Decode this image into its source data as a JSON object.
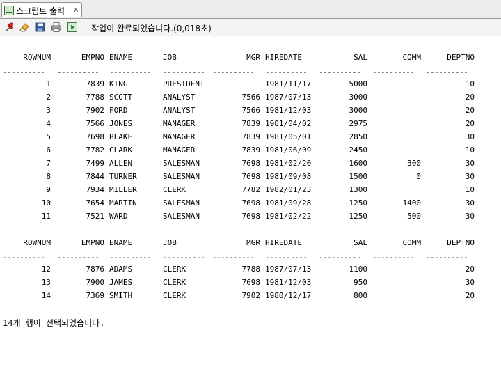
{
  "tab": {
    "label": "스크립트 출력",
    "close": "x"
  },
  "toolbar": {
    "status": "작업이 완료되었습니다.(0,018초)",
    "icons": [
      "pin-icon",
      "eraser-icon",
      "save-icon",
      "print-icon",
      "run-script-icon"
    ]
  },
  "columns": [
    "ROWNUM",
    "EMPNO",
    "ENAME",
    "JOB",
    "MGR",
    "HIREDATE",
    "SAL",
    "COMM",
    "DEPTNO"
  ],
  "dashes": "----------",
  "page1": [
    [
      "1",
      "7839",
      "KING",
      "PRESIDENT",
      "",
      "1981/11/17",
      "5000",
      "",
      "10"
    ],
    [
      "2",
      "7788",
      "SCOTT",
      "ANALYST",
      "7566",
      "1987/07/13",
      "3000",
      "",
      "20"
    ],
    [
      "3",
      "7902",
      "FORD",
      "ANALYST",
      "7566",
      "1981/12/03",
      "3000",
      "",
      "20"
    ],
    [
      "4",
      "7566",
      "JONES",
      "MANAGER",
      "7839",
      "1981/04/02",
      "2975",
      "",
      "20"
    ],
    [
      "5",
      "7698",
      "BLAKE",
      "MANAGER",
      "7839",
      "1981/05/01",
      "2850",
      "",
      "30"
    ],
    [
      "6",
      "7782",
      "CLARK",
      "MANAGER",
      "7839",
      "1981/06/09",
      "2450",
      "",
      "10"
    ],
    [
      "7",
      "7499",
      "ALLEN",
      "SALESMAN",
      "7698",
      "1981/02/20",
      "1600",
      "300",
      "30"
    ],
    [
      "8",
      "7844",
      "TURNER",
      "SALESMAN",
      "7698",
      "1981/09/08",
      "1500",
      "0",
      "30"
    ],
    [
      "9",
      "7934",
      "MILLER",
      "CLERK",
      "7782",
      "1982/01/23",
      "1300",
      "",
      "10"
    ],
    [
      "10",
      "7654",
      "MARTIN",
      "SALESMAN",
      "7698",
      "1981/09/28",
      "1250",
      "1400",
      "30"
    ],
    [
      "11",
      "7521",
      "WARD",
      "SALESMAN",
      "7698",
      "1981/02/22",
      "1250",
      "500",
      "30"
    ]
  ],
  "page2": [
    [
      "12",
      "7876",
      "ADAMS",
      "CLERK",
      "7788",
      "1987/07/13",
      "1100",
      "",
      "20"
    ],
    [
      "13",
      "7900",
      "JAMES",
      "CLERK",
      "7698",
      "1981/12/03",
      "950",
      "",
      "30"
    ],
    [
      "14",
      "7369",
      "SMITH",
      "CLERK",
      "7902",
      "1980/12/17",
      "800",
      "",
      "20"
    ]
  ],
  "footer": "14개 행이 선택되었습니다."
}
